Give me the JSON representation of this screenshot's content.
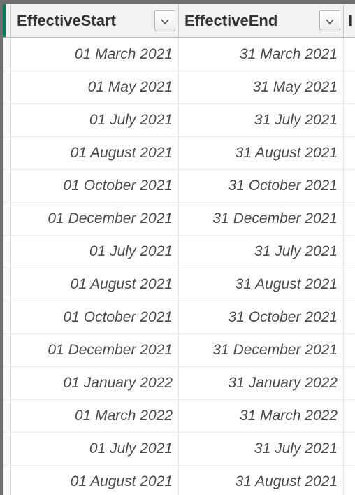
{
  "columns": [
    {
      "label": "EffectiveStart"
    },
    {
      "label": "EffectiveEnd"
    },
    {
      "partial": "I"
    }
  ],
  "rows": [
    {
      "start": "01 March 2021",
      "end": "31 March 2021"
    },
    {
      "start": "01 May 2021",
      "end": "31 May 2021"
    },
    {
      "start": "01 July 2021",
      "end": "31 July 2021"
    },
    {
      "start": "01 August 2021",
      "end": "31 August 2021"
    },
    {
      "start": "01 October 2021",
      "end": "31 October 2021"
    },
    {
      "start": "01 December 2021",
      "end": "31 December 2021"
    },
    {
      "start": "01 July 2021",
      "end": "31 July 2021"
    },
    {
      "start": "01 August 2021",
      "end": "31 August 2021"
    },
    {
      "start": "01 October 2021",
      "end": "31 October 2021"
    },
    {
      "start": "01 December 2021",
      "end": "31 December 2021"
    },
    {
      "start": "01 January 2022",
      "end": "31 January 2022"
    },
    {
      "start": "01 March 2022",
      "end": "31 March 2022"
    },
    {
      "start": "01 July 2021",
      "end": "31 July 2021"
    },
    {
      "start": "01 August 2021",
      "end": "31 August 2021"
    }
  ]
}
